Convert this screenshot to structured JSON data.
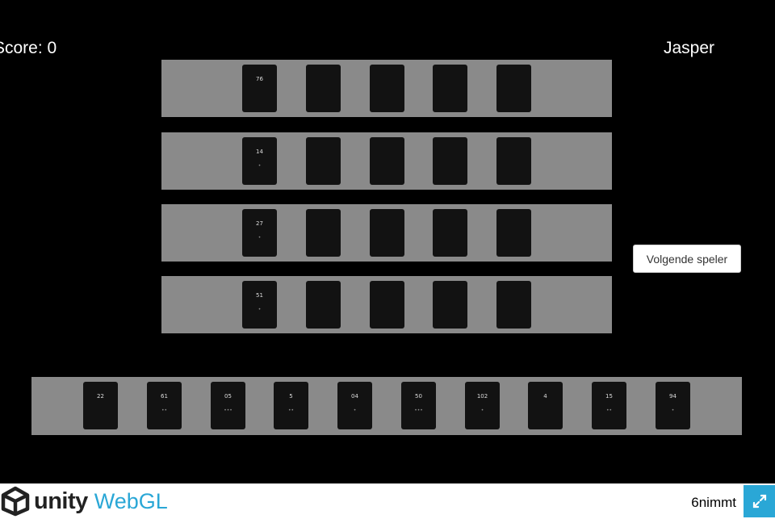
{
  "hud": {
    "score": "Score: 0",
    "player": "Jasper"
  },
  "rows": [
    {
      "cards": [
        {
          "num": "76",
          "pen": ""
        },
        {},
        {},
        {},
        {}
      ]
    },
    {
      "cards": [
        {
          "num": "14",
          "pen": "•"
        },
        {},
        {},
        {},
        {}
      ]
    },
    {
      "cards": [
        {
          "num": "27",
          "pen": "•"
        },
        {},
        {},
        {},
        {}
      ]
    },
    {
      "cards": [
        {
          "num": "51",
          "pen": "•"
        },
        {},
        {},
        {},
        {}
      ]
    }
  ],
  "hand": [
    {
      "num": "22",
      "pen": ""
    },
    {
      "num": "61",
      "pen": "••"
    },
    {
      "num": "05",
      "pen": "•••"
    },
    {
      "num": "5",
      "pen": "••"
    },
    {
      "num": "04",
      "pen": "•"
    },
    {
      "num": "50",
      "pen": "•••"
    },
    {
      "num": "102",
      "pen": "•"
    },
    {
      "num": "4",
      "pen": ""
    },
    {
      "num": "15",
      "pen": "••"
    },
    {
      "num": "94",
      "pen": "•"
    }
  ],
  "button": {
    "next_player": "Volgende speler"
  },
  "footer": {
    "logo_word": "unity",
    "logo_webgl": "WebGL",
    "app_name": "6nimmt",
    "accent": "#2aa7d6"
  },
  "icons": {
    "logo": "unity-cube-icon",
    "fullscreen": "fullscreen-icon"
  }
}
